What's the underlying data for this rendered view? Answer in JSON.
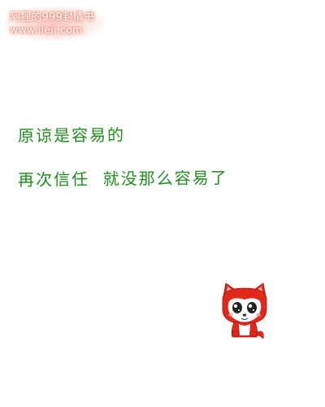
{
  "watermark": {
    "title": "阿狸的999封情书",
    "url": "www.iieii.com"
  },
  "message": {
    "line1": "原谅是容易的",
    "line2": "再次信任  就没那么容易了"
  },
  "character": {
    "icon": "ali-fox-icon"
  },
  "colors": {
    "text": "#1f8e1f",
    "watermark_glow": "#e8826f",
    "fox_red": "#e0291b"
  }
}
